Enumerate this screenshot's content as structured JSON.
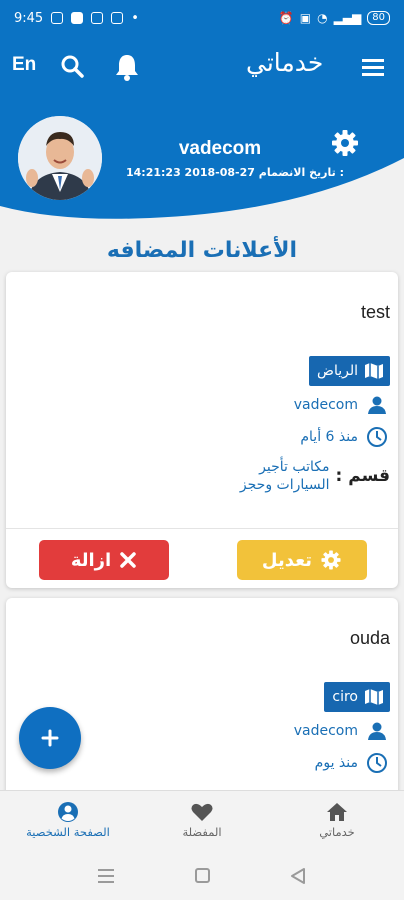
{
  "status_bar": {
    "time": "9:45",
    "battery": "80"
  },
  "header": {
    "lang": "En",
    "title": "خدماتي",
    "icons": {
      "menu": "hamburger-menu-icon",
      "search": "search-icon",
      "notifications": "bell-icon",
      "settings": "gear-icon"
    },
    "colors": {
      "primary": "#0b73c4"
    }
  },
  "profile": {
    "name": "vadecom",
    "joined_label": "تاريخ الانضمام :",
    "joined_value": "14:21:23 2018-08-27"
  },
  "section_title": "الأعلانات المضافه",
  "ads": [
    {
      "title": "test",
      "location": "الرياض",
      "user": "vadecom",
      "time": "منذ 6 أيام",
      "category_label": "قسم :",
      "category": "مكاتب تأجير السيارات وحجز",
      "edit_label": "تعديل",
      "delete_label": "ازالة"
    },
    {
      "title": "ouda",
      "location": "ciro",
      "user": "vadecom",
      "time": "منذ يوم"
    }
  ],
  "fab_label": "+",
  "bottom_nav": [
    {
      "label": "خدماتي",
      "icon": "home-icon"
    },
    {
      "label": "المفضلة",
      "icon": "heart-icon"
    },
    {
      "label": "الصفحة الشخصية",
      "icon": "account-icon",
      "active": true
    }
  ]
}
